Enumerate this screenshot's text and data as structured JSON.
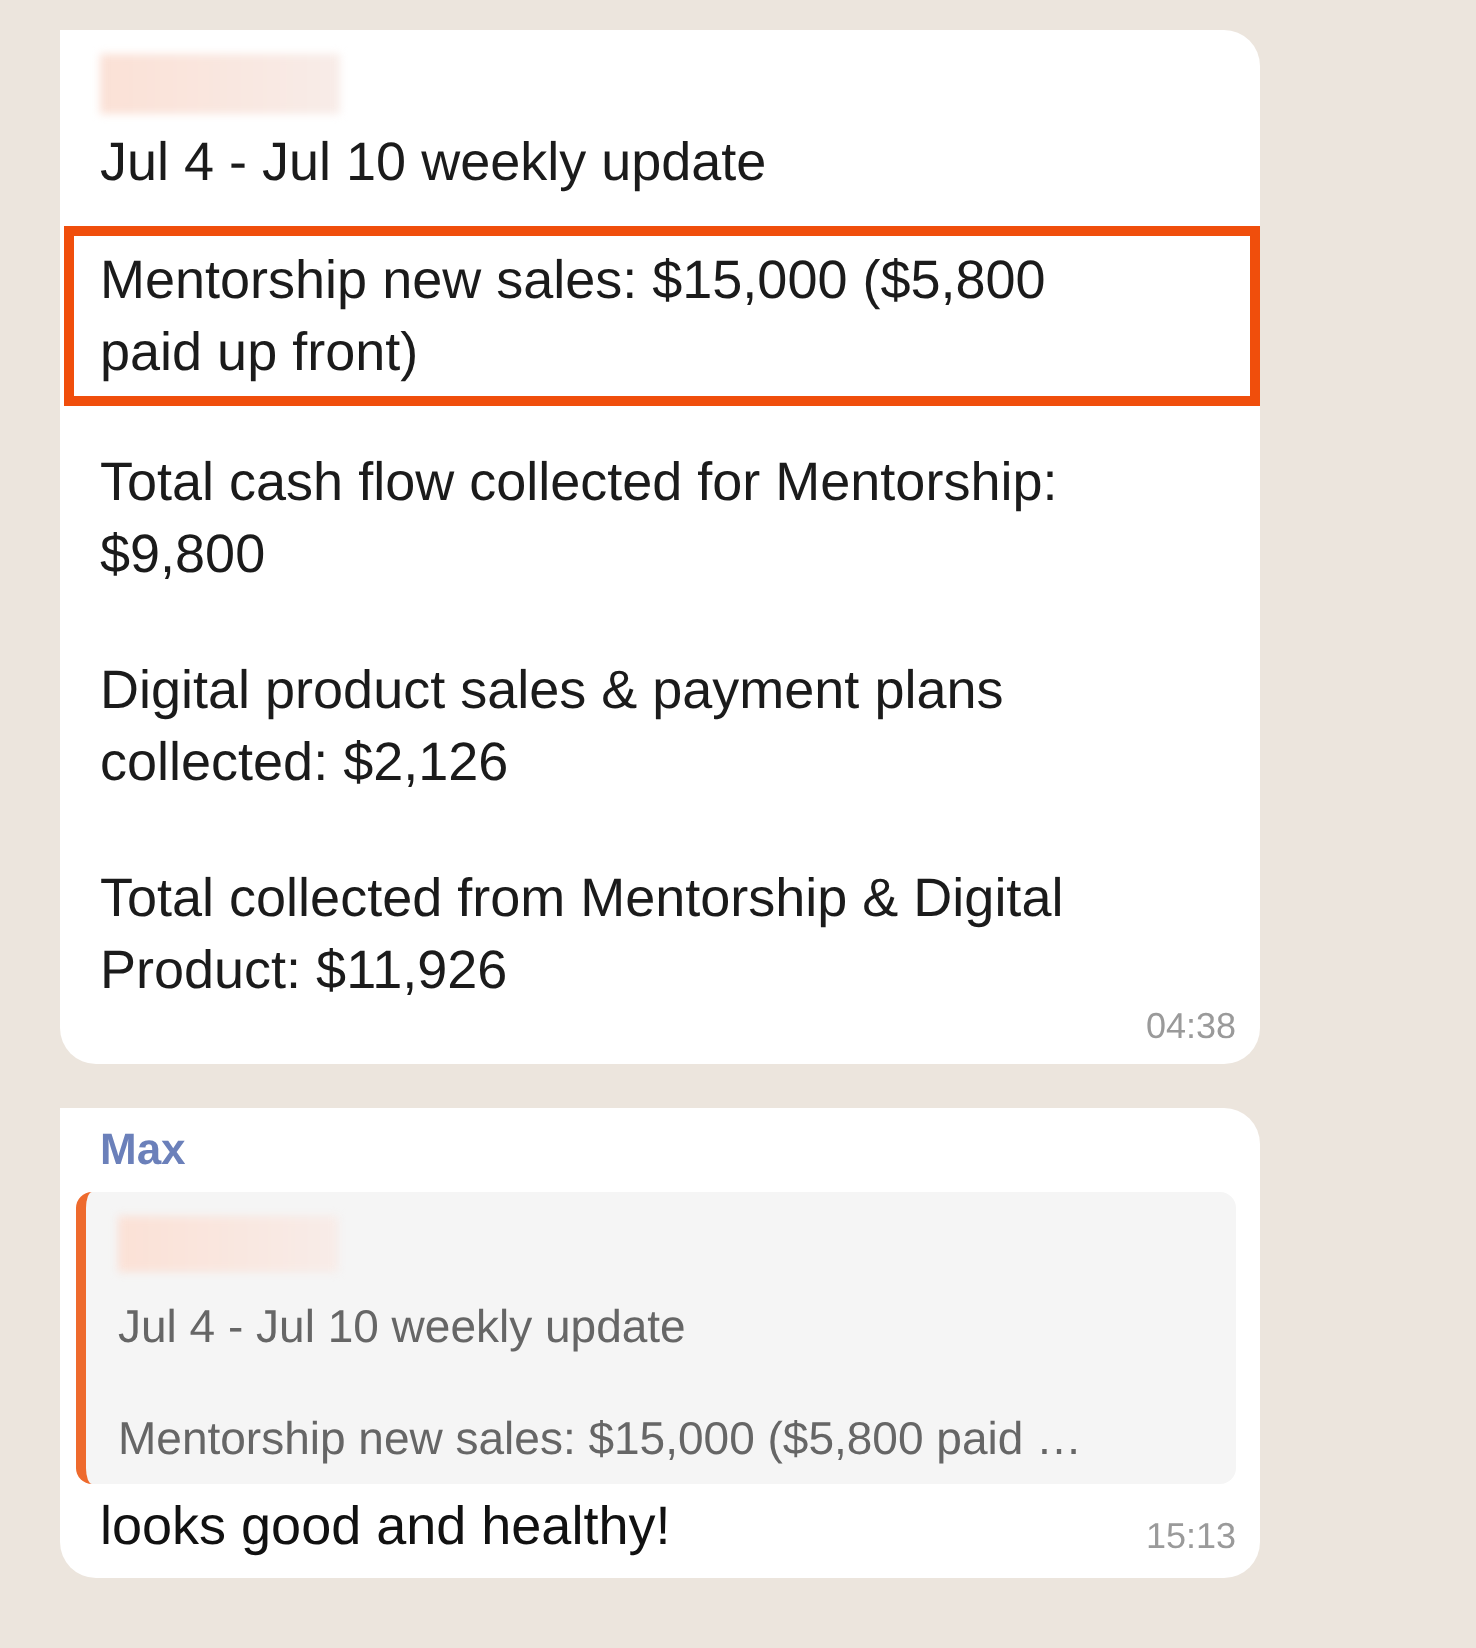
{
  "messages": [
    {
      "kind": "post",
      "paragraphs": [
        {
          "text": "Jul 4 - Jul 10 weekly update",
          "highlighted": false
        },
        {
          "text": "Mentorship new sales: $15,000 ($5,800 paid up front)",
          "highlighted": true
        },
        {
          "text": "Total cash flow collected for Mentorship: $9,800",
          "highlighted": false
        },
        {
          "text": "Digital product sales & payment plans collected: $2,126",
          "highlighted": false
        },
        {
          "text": "Total collected from Mentorship & Digital Product: $11,926",
          "highlighted": false
        }
      ],
      "time": "04:38"
    },
    {
      "kind": "reply",
      "sender": "Max",
      "quote": {
        "lines": [
          "Jul 4 - Jul 10 weekly update",
          "Mentorship new sales: $15,000 ($5,800 paid …"
        ]
      },
      "text": "looks good and healthy!",
      "time": "15:13"
    }
  ]
}
